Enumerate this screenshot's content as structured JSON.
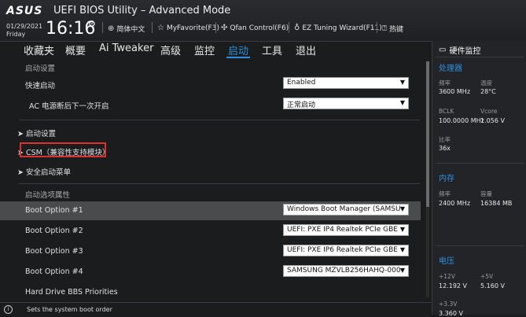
{
  "header": {
    "logo": "ASUS",
    "title": "UEFI BIOS Utility – Advanced Mode",
    "date": "01/29/2021",
    "day": "Friday",
    "time": "16:16",
    "tools": [
      {
        "icon": "globe-icon",
        "label": "简体中文"
      },
      {
        "icon": "star-icon",
        "label": "MyFavorite(F3)"
      },
      {
        "icon": "fan-icon",
        "label": "Qfan Control(F6)"
      },
      {
        "icon": "bulb-icon",
        "label": "EZ Tuning Wizard(F11)"
      },
      {
        "icon": "help-icon",
        "label": "热键"
      }
    ]
  },
  "menu": {
    "items": [
      "收藏夹",
      "概要",
      "Ai Tweaker",
      "高级",
      "监控",
      "启动",
      "工具",
      "退出"
    ],
    "active": "启动"
  },
  "boot": {
    "section_boot_config": "启动设置",
    "fast_boot_label": "快速启动",
    "fast_boot_value": "Enabled",
    "ac_power_label": "AC 电源断后下一次开启",
    "ac_power_value": "正常启动",
    "boot_config_link": "启动设置",
    "csm_link": "CSM（兼容性支持模块）",
    "secure_boot_link": "安全启动菜单",
    "section_boot_priority": "启动选项属性",
    "options": [
      {
        "label": "Boot Option #1",
        "value": "Windows Boot Manager (SAMSU"
      },
      {
        "label": "Boot Option #2",
        "value": "UEFI: PXE IP4 Realtek PCIe GBE"
      },
      {
        "label": "Boot Option #3",
        "value": "UEFI: PXE IP6 Realtek PCIe GBE"
      },
      {
        "label": "Boot Option #4",
        "value": "SAMSUNG MZVLB256HAHQ-000"
      }
    ],
    "hdd_bbs": "Hard Drive BBS Priorities"
  },
  "help_text": "Sets the system boot order",
  "hw_monitor": {
    "title": "硬件监控",
    "cpu": {
      "section": "处理器",
      "freq_label": "频率",
      "freq_value": "3600 MHz",
      "temp_label": "温度",
      "temp_value": "28°C",
      "bclk_label": "BCLK",
      "bclk_value": "100.0000 MHz",
      "vcore_label": "Vcore",
      "vcore_value": "1.056 V",
      "ratio_label": "比率",
      "ratio_value": "36x"
    },
    "memory": {
      "section": "内存",
      "freq_label": "频率",
      "freq_value": "2400 MHz",
      "cap_label": "容量",
      "cap_value": "16384 MB"
    },
    "voltage": {
      "section": "电压",
      "v12_label": "+12V",
      "v12_value": "12.192 V",
      "v5_label": "+5V",
      "v5_value": "5.160 V",
      "v33_label": "+3.3V",
      "v33_value": "3.360 V"
    }
  },
  "colors": {
    "accent": "#2f8fe0",
    "highlight_box": "#e03030"
  }
}
